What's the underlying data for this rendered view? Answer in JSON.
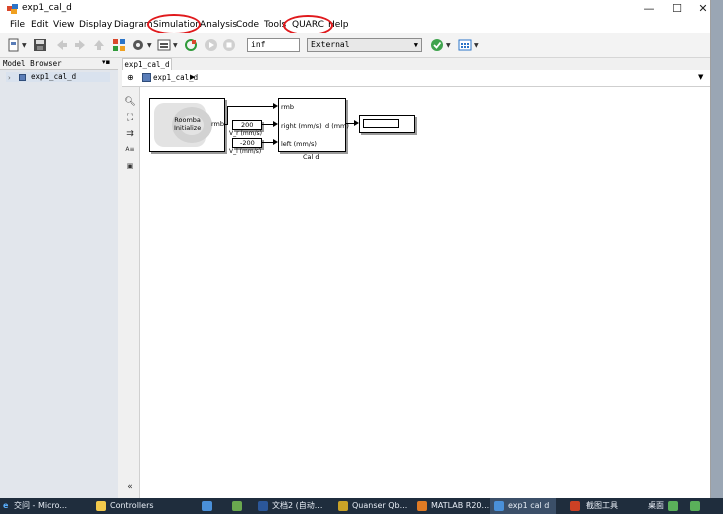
{
  "window": {
    "title": "exp1_cal_d",
    "controls": {
      "minimize": "—",
      "maximize": "☐",
      "close": "✕"
    }
  },
  "menu": [
    "File",
    "Edit",
    "View",
    "Display",
    "Diagram",
    "Simulation",
    "Analysis",
    "Code",
    "Tools",
    "QUARC",
    "Help"
  ],
  "highlights": {
    "ring_color": "#e0191c",
    "rings_on": [
      "Simulation",
      "QUARC"
    ]
  },
  "toolbar": {
    "stop_time": "inf",
    "sim_mode": "External",
    "icons": [
      "new-model-icon",
      "save-icon",
      "back-icon",
      "forward-icon",
      "up-icon",
      "library-browser-icon",
      "model-settings-icon",
      "model-advisor-icon",
      "step-back-icon",
      "run-icon",
      "stop-icon",
      "model-check-icon",
      "build-icon"
    ]
  },
  "model_browser": {
    "title": "Model Browser",
    "items": [
      {
        "label": "exp1_cal_d"
      }
    ]
  },
  "editor": {
    "tab": "exp1_cal_d",
    "breadcrumb": "exp1_cal_d"
  },
  "diagram": {
    "roomba_block": {
      "label": "Roomba\nInitialize",
      "port": "rmb"
    },
    "const_right": {
      "value": "200",
      "name": "V_r (mm/s)"
    },
    "const_left": {
      "value": "-200",
      "name": "V_l (mm/s)"
    },
    "subsystem": {
      "name": "Cal d",
      "inputs": [
        "rmb",
        "right (mm/s)",
        "left (mm/s)"
      ],
      "outputs": [
        "d (mm)"
      ]
    },
    "display": {
      "value": ""
    }
  },
  "taskbar": {
    "items": [
      "交问 - Micro...",
      "Controllers",
      "文档2 (自动...",
      "Quanser Qb...",
      "MATLAB R20...",
      "exp1 cal d",
      "截图工具"
    ],
    "right_labels": [
      "桌面"
    ]
  }
}
